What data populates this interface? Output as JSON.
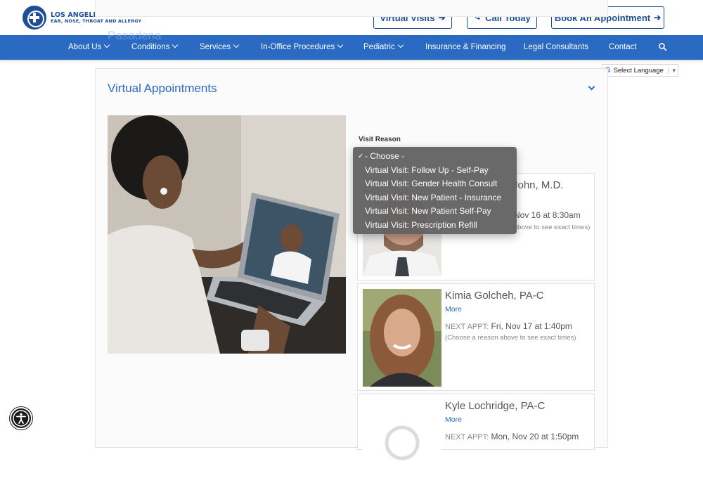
{
  "header": {
    "logo_line1": "LOS ANGELES CENTER FOR",
    "logo_line2": "EAR, NOSE, THROAT AND ALLERGY",
    "virtual_visits": "Virtual Visits",
    "call_today": "Call Today",
    "book_appointment": "Book An Appointment"
  },
  "nav": {
    "ghost_text": "Pasadena",
    "items": [
      {
        "label": "About Us"
      },
      {
        "label": "Conditions"
      },
      {
        "label": "Services"
      },
      {
        "label": "In-Office Procedures"
      },
      {
        "label": "Pediatric"
      },
      {
        "label": "Insurance & Financing"
      },
      {
        "label": "Legal Consultants"
      },
      {
        "label": "Contact"
      }
    ]
  },
  "translate": {
    "label": "Select Language",
    "g": "G"
  },
  "section": {
    "title": "Virtual Appointments",
    "visit_reason_label": "Visit Reason"
  },
  "dropdown": {
    "options": [
      "- Choose -",
      "Virtual Visit: Follow Up - Self-Pay",
      "Virtual Visit: Gender Health Consult",
      "Virtual Visit: New Patient - Insurance",
      "Virtual Visit: New Patient Self-Pay",
      "Virtual Visit: Prescription Refill"
    ],
    "selected_index": 0
  },
  "providers": [
    {
      "name": "John, M.D.",
      "more": "",
      "appt_label": "",
      "appt": "Nov 16 at 8:30am",
      "hint": "above to see exact times)"
    },
    {
      "name": "Kimia Golcheh, PA-C",
      "more": "More",
      "appt_label": "NEXT APPT:",
      "appt": "Fri, Nov 17 at 1:40pm",
      "hint": "(Choose a reason above to see exact times)"
    },
    {
      "name": "Kyle Lochridge, PA-C",
      "more": "More",
      "appt_label": "NEXT APPT:",
      "appt": "Mon, Nov 20 at 1:50pm",
      "hint": ""
    }
  ],
  "colors": {
    "brand_blue": "#2a6ac3",
    "logo_navy": "#1e4f96"
  }
}
